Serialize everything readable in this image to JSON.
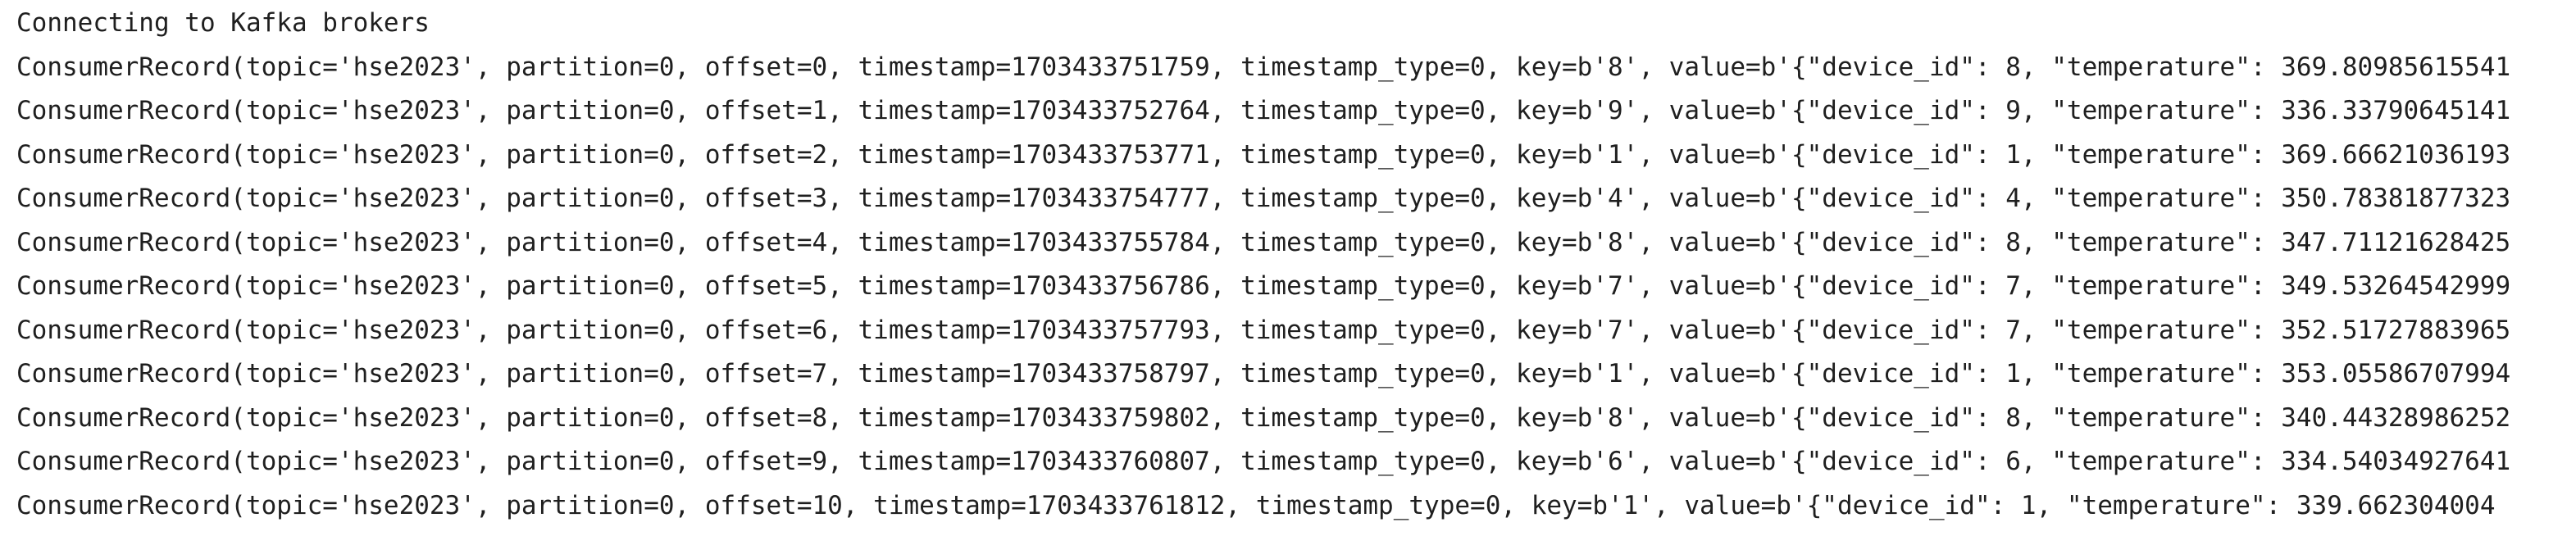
{
  "console": {
    "lines": [
      "Connecting to Kafka brokers",
      "ConsumerRecord(topic='hse2023', partition=0, offset=0, timestamp=1703433751759, timestamp_type=0, key=b'8', value=b'{\"device_id\": 8, \"temperature\": 369.80985615541",
      "ConsumerRecord(topic='hse2023', partition=0, offset=1, timestamp=1703433752764, timestamp_type=0, key=b'9', value=b'{\"device_id\": 9, \"temperature\": 336.33790645141",
      "ConsumerRecord(topic='hse2023', partition=0, offset=2, timestamp=1703433753771, timestamp_type=0, key=b'1', value=b'{\"device_id\": 1, \"temperature\": 369.66621036193",
      "ConsumerRecord(topic='hse2023', partition=0, offset=3, timestamp=1703433754777, timestamp_type=0, key=b'4', value=b'{\"device_id\": 4, \"temperature\": 350.78381877323",
      "ConsumerRecord(topic='hse2023', partition=0, offset=4, timestamp=1703433755784, timestamp_type=0, key=b'8', value=b'{\"device_id\": 8, \"temperature\": 347.71121628425",
      "ConsumerRecord(topic='hse2023', partition=0, offset=5, timestamp=1703433756786, timestamp_type=0, key=b'7', value=b'{\"device_id\": 7, \"temperature\": 349.53264542999",
      "ConsumerRecord(topic='hse2023', partition=0, offset=6, timestamp=1703433757793, timestamp_type=0, key=b'7', value=b'{\"device_id\": 7, \"temperature\": 352.51727883965",
      "ConsumerRecord(topic='hse2023', partition=0, offset=7, timestamp=1703433758797, timestamp_type=0, key=b'1', value=b'{\"device_id\": 1, \"temperature\": 353.05586707994",
      "ConsumerRecord(topic='hse2023', partition=0, offset=8, timestamp=1703433759802, timestamp_type=0, key=b'8', value=b'{\"device_id\": 8, \"temperature\": 340.44328986252",
      "ConsumerRecord(topic='hse2023', partition=0, offset=9, timestamp=1703433760807, timestamp_type=0, key=b'6', value=b'{\"device_id\": 6, \"temperature\": 334.54034927641",
      "ConsumerRecord(topic='hse2023', partition=0, offset=10, timestamp=1703433761812, timestamp_type=0, key=b'1', value=b'{\"device_id\": 1, \"temperature\": 339.662304004"
    ]
  }
}
